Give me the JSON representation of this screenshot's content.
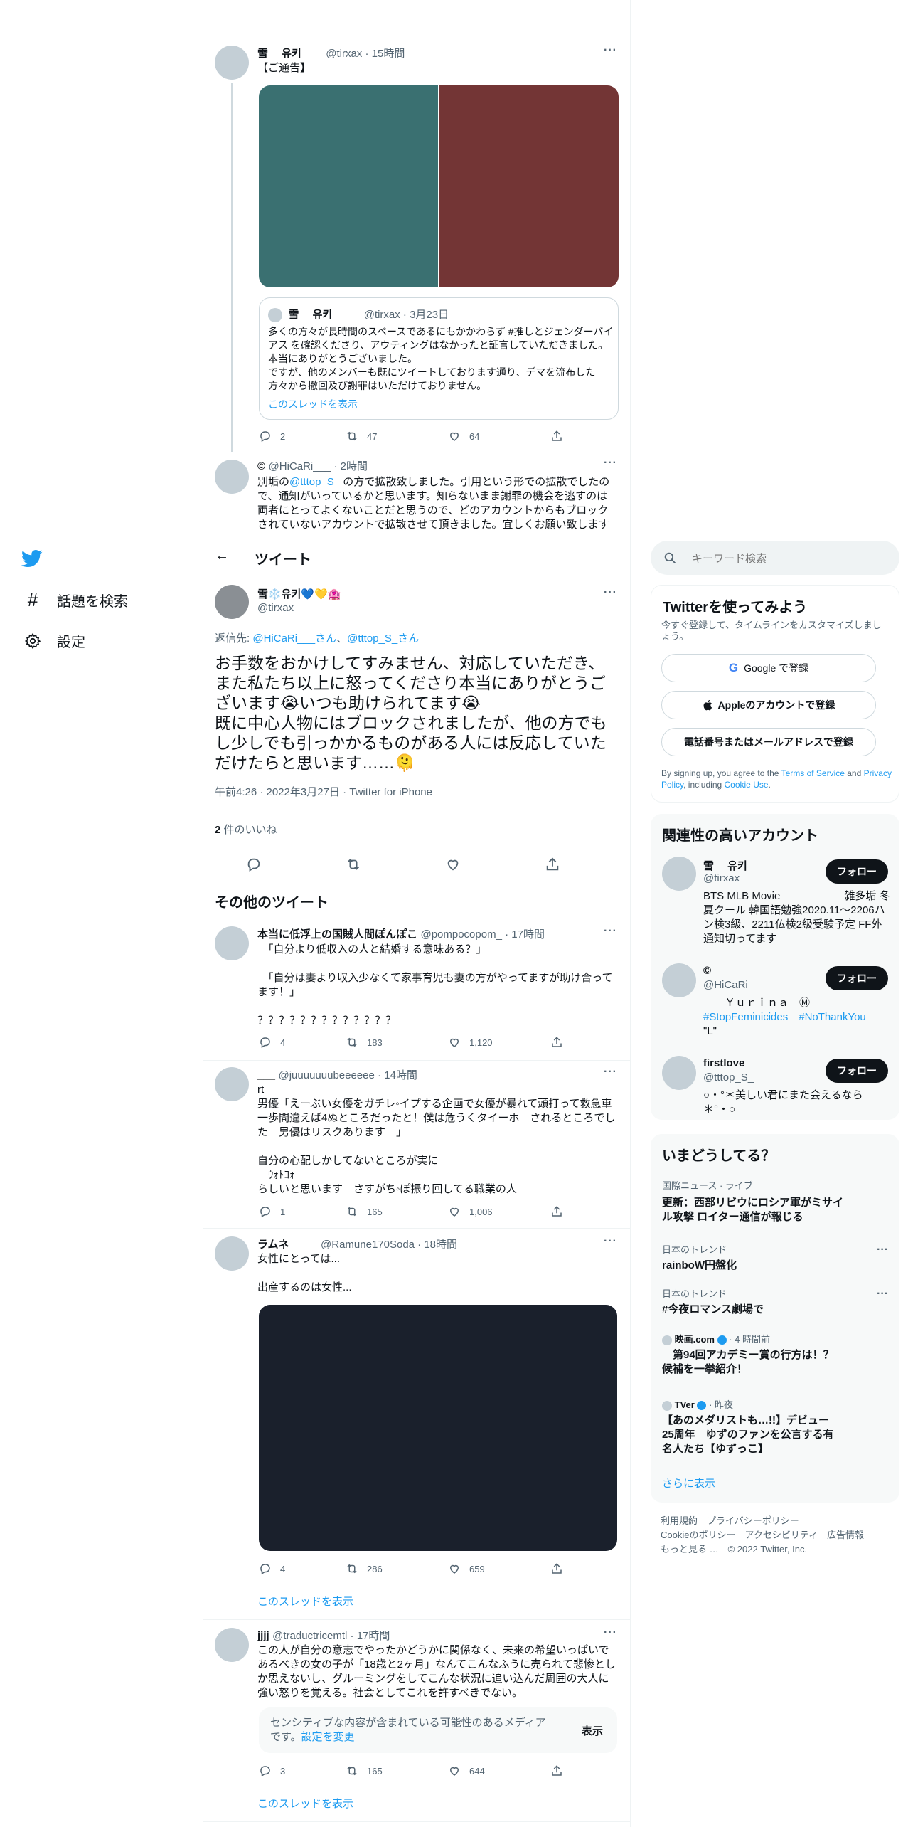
{
  "left_nav": {
    "items": [
      {
        "label": "話題を検索",
        "icon": "hashtag-icon"
      },
      {
        "label": "設定",
        "icon": "gear-icon"
      }
    ]
  },
  "thread_top": {
    "tweet1": {
      "name": "雪　 유키",
      "handle_time": "@tirxax · 15時間",
      "text": "【ご通告】",
      "quote": {
        "name": "雪　 유키",
        "handle_time": "@tirxax · 3月23日",
        "text": "多くの方々が長時間のスペースであるにもかかわらず #推しとジェンダーバイアス を確認くださり、アウティングはなかったと証言していただきました。本当にありがとうございました。\nですが、他のメンバーも既にツイートしております通り、デマを流布した方々から撤回及び謝罪はいただけておりません。",
        "show_thread": "このスレッドを表示"
      },
      "reply_count": "2",
      "retweet_count": "47",
      "like_count": "64",
      "colors": {
        "image_left": "#3a7071",
        "image_right": "#733535"
      }
    },
    "tweet2": {
      "name": "©",
      "handle_time": "@HiCaRi___ · 2時間",
      "text_pre": "別垢の",
      "text_mention": "@tttop_S_",
      "text_post": " の方で拡散致しました。引用という形での拡散でしたので、通知がいっているかと思います。知らないまま謝罪の機会を逃すのは両者にとってよくないことだと思うので、どのアカウントからもブロックされていないアカウントで拡散させて頂きました。宜しくお願い致します"
    }
  },
  "header": {
    "back_arrow": "←",
    "title": "ツイート"
  },
  "main_tweet": {
    "name": "雪❄️유키💙💛🏩",
    "handle": "@tirxax",
    "reply_to_label": "返信先: ",
    "reply_to_1": "@HiCaRi___さん",
    "reply_to_sep": "、",
    "reply_to_2": "@tttop_S_さん",
    "text": "お手数をおかけしてすみません、対応していただき、また私たち以上に怒ってくださり本当にありがとうございます😭いつも助けられてます😭\n既に中心人物にはブロックされましたが、他の方でもし少しでも引っかかるものがある人には反応していただけたらと思います……🫠",
    "meta": "午前4:26 · 2022年3月27日 · Twitter for iPhone",
    "likes_num": "2",
    "likes_label": " 件のいいね"
  },
  "more_tweets": {
    "heading": "その他のツイート",
    "t1": {
      "name": "本当に低浮上の国賊人間ぽんぽこ",
      "handle_time": "@pompocopom_ · 17時間",
      "text": "　「自分より低収入の人と結婚する意味ある？」\n\n　「自分は妻より収入少なくて家事育児も妻の方がやってますが助け合ってます！」\n\n？？？？？？？？？？？？？",
      "reply": "4",
      "retweet": "183",
      "like": "1,120"
    },
    "t2": {
      "name": "___",
      "handle_time": "@juuuuuuubeeeeee · 14時間",
      "text": "rt\n男優「えーぶい女優をガチレ◦イプする企画で女優が暴れて頭打って救急車　一歩間違えば4ぬところだったと！僕は危うくタイーホ　されるところでした　男優はリスクあります　」\n\n自分の心配しかしてないところが実に\n　ｳｫﾄｺｫ\nらしいと思います　さすがち◦ぽ振り回してる職業の人",
      "reply": "1",
      "retweet": "165",
      "like": "1,006"
    },
    "t3": {
      "name": "ラムネ",
      "handle_time": "@Ramune170Soda · 18時間",
      "text": "女性にとっては...\n\n出産するのは女性...",
      "reply": "4",
      "retweet": "286",
      "like": "659",
      "show_thread": "このスレッドを表示",
      "image_color": "#1a202c"
    },
    "t4": {
      "name": "jjjj",
      "handle_time": "@traductricemtl · 17時間",
      "text": "この人が自分の意志でやったかどうかに関係なく、未来の希望いっぱいであるべきの女の子が「18歳と2ヶ月」なんてこんなふうに売られて悲惨としか思えないし、グルーミングをしてこんな状況に追い込んだ周囲の大人に強い怒りを覚える。社会としてこれを許すべきでない。",
      "sensitive_text": "センシティブな内容が含まれている可能性のあるメディアです。",
      "sensitive_link": "設定を変更",
      "show_button": "表示",
      "reply": "3",
      "retweet": "165",
      "like": "644",
      "show_thread": "このスレッドを表示"
    }
  },
  "search": {
    "placeholder": "キーワード検索"
  },
  "signup": {
    "title": "Twitterを使ってみよう",
    "subtitle": "今すぐ登録して、タイムラインをカスタマイズしましょう。",
    "google": "Google で登録",
    "apple": "Appleのアカウントで登録",
    "phone": "電話番号またはメールアドレスで登録",
    "terms_1": "By signing up, you agree to the ",
    "terms_link1": "Terms of Service",
    "terms_2": " and ",
    "terms_link2": "Privacy Policy",
    "terms_3": ", including ",
    "terms_link3": "Cookie Use",
    "terms_4": "."
  },
  "related": {
    "title": "関連性の高いアカウント",
    "follow_label": "フォロー",
    "accounts": [
      {
        "name": "雪　 유키",
        "handle": "@tirxax",
        "bio": "BTS MLB Movie　　　　　　雑多垢 冬夏クール 韓国語勉強2020.11〜2206ハン検3級、2211仏検2級受験予定 FF外通知切ってます"
      },
      {
        "name": "©",
        "handle": "@HiCaRi___",
        "bio_1": "　　Ｙｕｒｉｎａ　Ⓜ",
        "bio_tag1": "#StopFeminicides",
        "bio_tag2": "#NoThankYou",
        "bio_2": "\"L\""
      },
      {
        "name": "firstlove",
        "handle": "@tttop_S_",
        "bio": "○・°＊美しい君にまた会えるなら　＊°・○"
      }
    ]
  },
  "trends": {
    "title": "いまどうしてる？",
    "items": [
      {
        "context": "国際ニュース · ライブ",
        "title": "更新：西部リビウにロシア軍がミサイル攻撃 ロイター通信が報じる"
      },
      {
        "context": "日本のトレンド",
        "title": "rainboW円盤化"
      },
      {
        "context": "日本のトレンド",
        "title": "#今夜ロマンス劇場で"
      },
      {
        "context_name": "映画.com",
        "context_time": "· 4 時間前",
        "title": "　第94回アカデミー賞の行方は！？　候補を一挙紹介！"
      },
      {
        "context_name": "TVer",
        "context_time": "· 昨夜",
        "title": "【あのメダリストも…!!】デビュー25周年　ゆずのファンを公言する有名人たち【ゆずっこ】"
      }
    ],
    "show_more": "さらに表示"
  },
  "footer": {
    "line1": "利用規約　プライバシーポリシー",
    "line2": "Cookieのポリシー　アクセシビリティ　広告情報",
    "line3": "もっと見る …　© 2022 Twitter, Inc."
  },
  "colors": {
    "accent": "#1d9bf0",
    "dark": "#0f1419",
    "muted": "#536471"
  }
}
